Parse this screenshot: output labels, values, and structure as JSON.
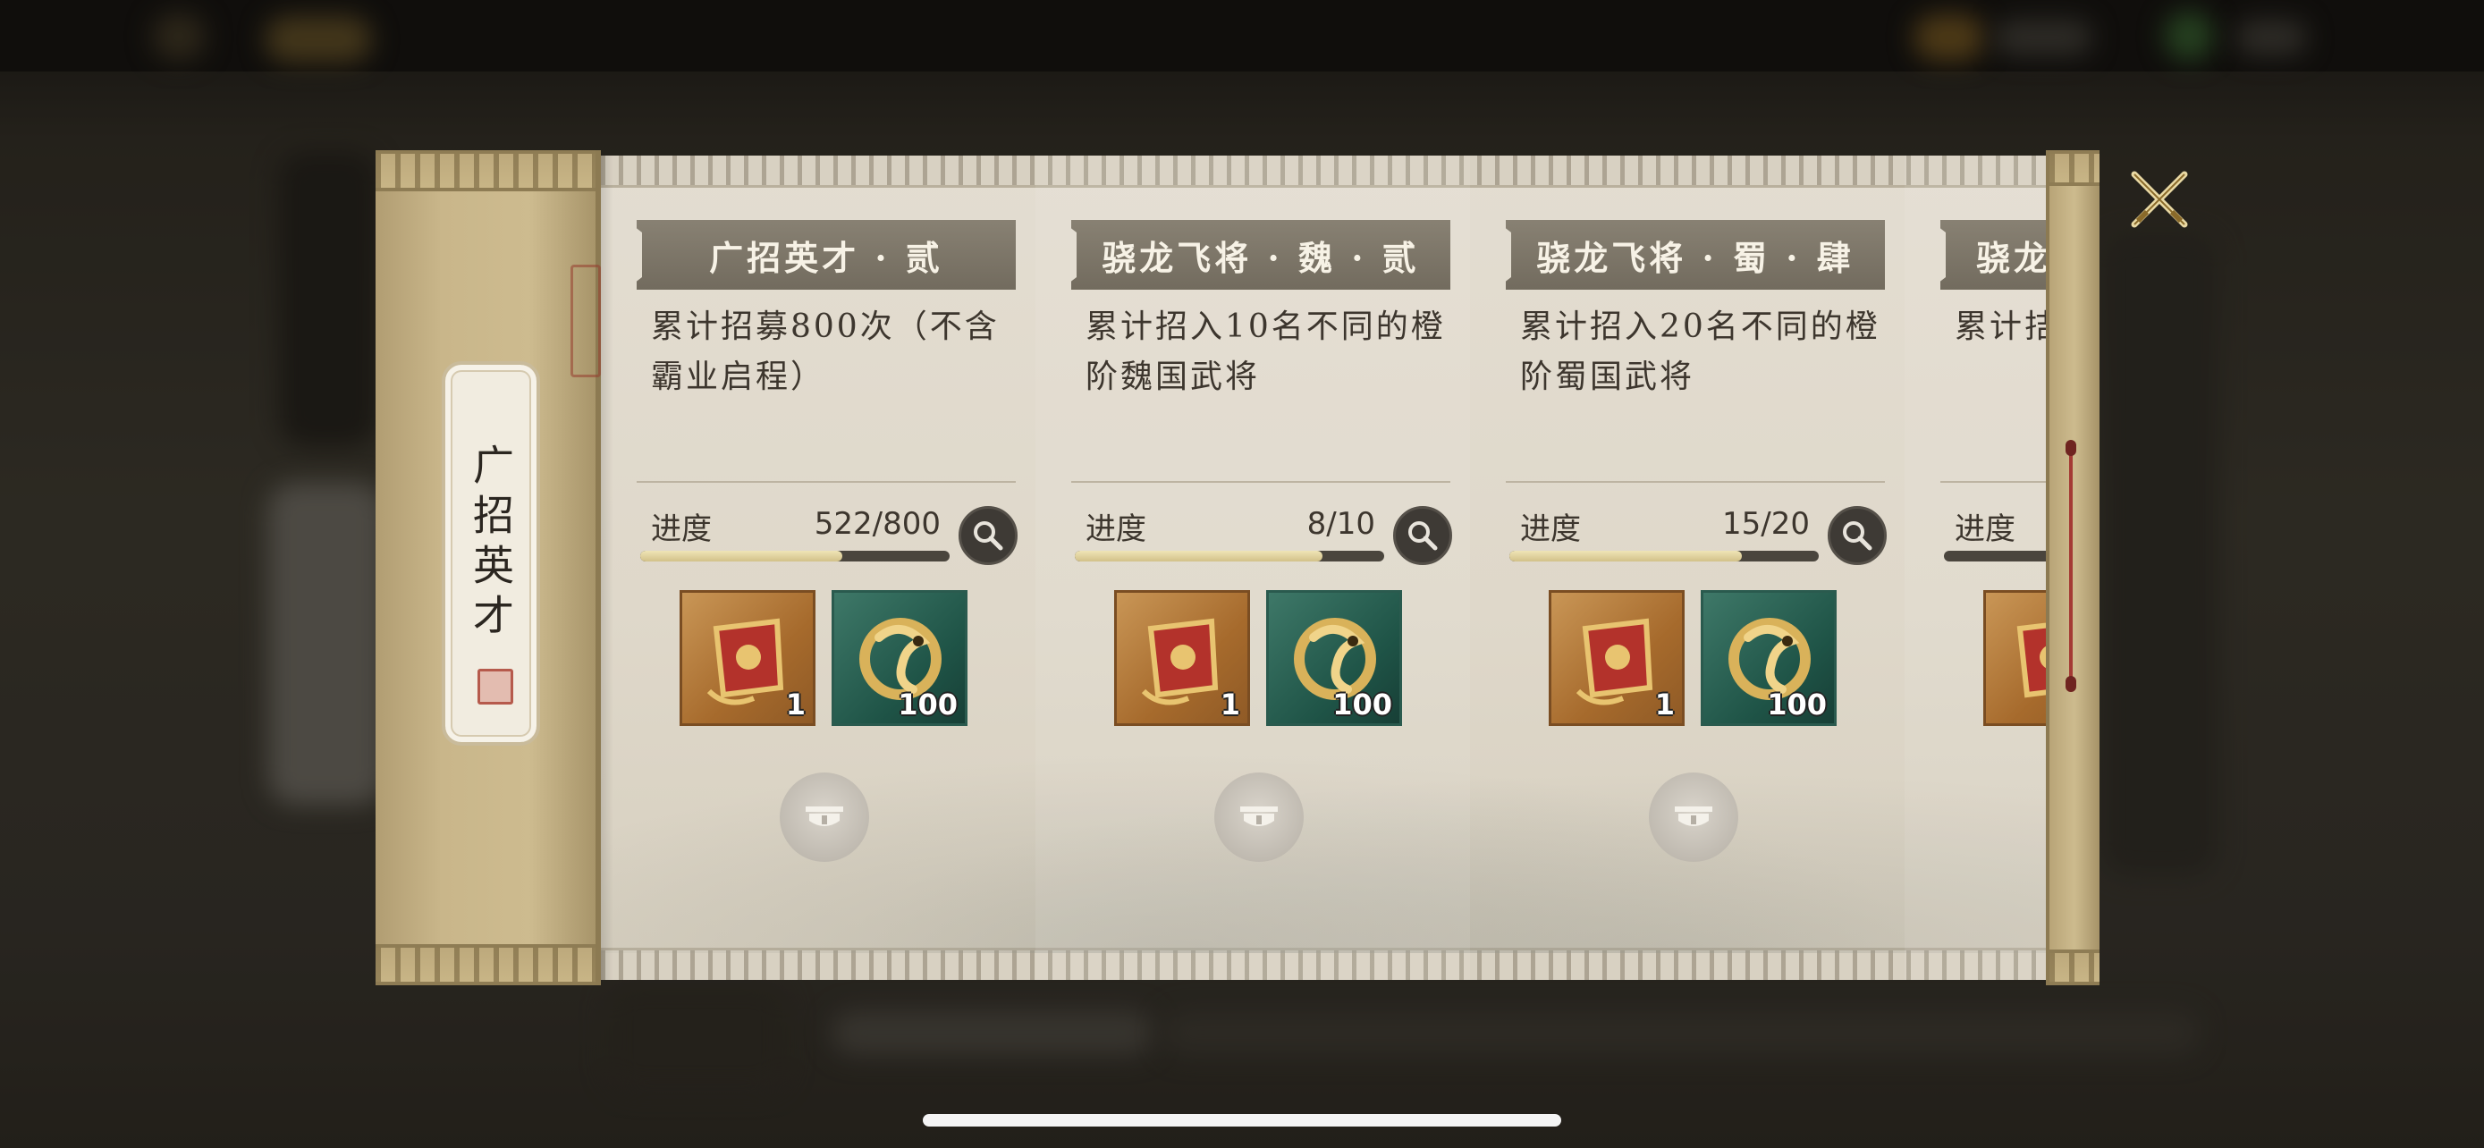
{
  "panel": {
    "title": "广招英才"
  },
  "progress_label": "进度",
  "cards": [
    {
      "title": "广招英才 · 贰",
      "description": "累计招募800次（不含霸业启程）",
      "progress_text": "522/800",
      "progress": 0.6525,
      "rewards": [
        {
          "icon": "red-banner-token-icon",
          "qty": "1"
        },
        {
          "icon": "golden-dragon-emblem-icon",
          "qty": "100"
        }
      ]
    },
    {
      "title": "骁龙飞将 · 魏 · 贰",
      "description": "累计招入10名不同的橙阶魏国武将",
      "progress_text": "8/10",
      "progress": 0.8,
      "rewards": [
        {
          "icon": "red-banner-token-icon",
          "qty": "1"
        },
        {
          "icon": "golden-dragon-emblem-icon",
          "qty": "100"
        }
      ]
    },
    {
      "title": "骁龙飞将 · 蜀 · 肆",
      "description": "累计招入20名不同的橙阶蜀国武将",
      "progress_text": "15/20",
      "progress": 0.75,
      "rewards": [
        {
          "icon": "red-banner-token-icon",
          "qty": "1"
        },
        {
          "icon": "golden-dragon-emblem-icon",
          "qty": "100"
        }
      ]
    },
    {
      "title": "骁龙",
      "description": "累计拮阶吴国",
      "progress_text": "",
      "progress": 0.0,
      "rewards": [
        {
          "icon": "red-banner-token-icon",
          "qty": ""
        }
      ]
    }
  ],
  "colors": {
    "banner": "#7d7669",
    "progress_fill": "#e3d6a3",
    "progress_track": "#4a453d",
    "scroll_gold": "#c5b285",
    "scrollbar_red": "#a43a34"
  }
}
